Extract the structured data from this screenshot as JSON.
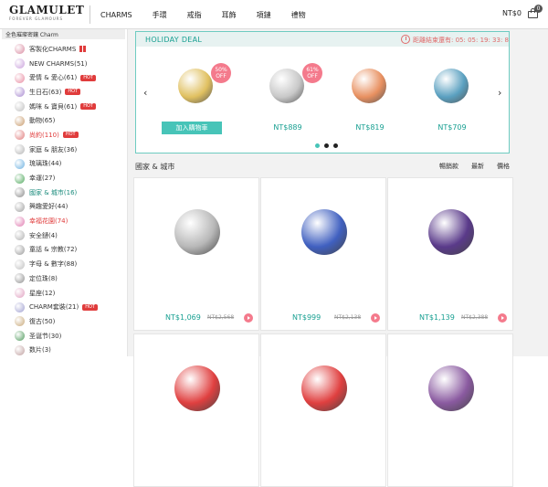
{
  "header": {
    "logo": "GLAMULET",
    "logo_sub": "FOREVER GLAMOURS",
    "nav": [
      "CHARMS",
      "手環",
      "戒指",
      "耳飾",
      "項鏈",
      "禮物"
    ],
    "cart_total": "NT$0",
    "cart_count": "0"
  },
  "sidebar": {
    "header": "全色璀璨密鑲 Charm",
    "items": [
      {
        "label": "客製化CHARMS",
        "badge": "gift",
        "style": "normal",
        "color": "#d98aa0"
      },
      {
        "label": "NEW CHARMS(51)",
        "badge": "",
        "style": "normal",
        "color": "#c9a0dc"
      },
      {
        "label": "愛情 & 愛心(61)",
        "badge": "HOT",
        "style": "normal",
        "color": "#e88aa0"
      },
      {
        "label": "生日石(63)",
        "badge": "HOT",
        "style": "normal",
        "color": "#a889d0"
      },
      {
        "label": "媽咪 & 寶貝(61)",
        "badge": "HOT",
        "style": "normal",
        "color": "#c0c0c0"
      },
      {
        "label": "動物(65)",
        "badge": "",
        "style": "normal",
        "color": "#c89a6a"
      },
      {
        "label": "尚約(110)",
        "badge": "HOT",
        "style": "red",
        "color": "#e07a7a"
      },
      {
        "label": "家庭 & 朋友(36)",
        "badge": "",
        "style": "normal",
        "color": "#b5b5b5"
      },
      {
        "label": "琉璃珠(44)",
        "badge": "",
        "style": "normal",
        "color": "#6ab0e0"
      },
      {
        "label": "幸運(27)",
        "badge": "",
        "style": "normal",
        "color": "#4fa85c"
      },
      {
        "label": "國家 & 城市(16)",
        "badge": "",
        "style": "teal",
        "color": "#8a8a8a"
      },
      {
        "label": "興趣愛好(44)",
        "badge": "",
        "style": "normal",
        "color": "#a0a0a0"
      },
      {
        "label": "幸福花園(74)",
        "badge": "",
        "style": "red",
        "color": "#e07ab0"
      },
      {
        "label": "安全鏈(4)",
        "badge": "",
        "style": "normal",
        "color": "#b0b0b0"
      },
      {
        "label": "童話 & 宗教(72)",
        "badge": "",
        "style": "normal",
        "color": "#9a9a9a"
      },
      {
        "label": "字母 & 數字(88)",
        "badge": "",
        "style": "normal",
        "color": "#c0c0c0"
      },
      {
        "label": "定位珠(8)",
        "badge": "",
        "style": "normal",
        "color": "#909090"
      },
      {
        "label": "星座(12)",
        "badge": "",
        "style": "normal",
        "color": "#e0a0c0"
      },
      {
        "label": "CHARM套裝(21)",
        "badge": "HOT",
        "style": "normal",
        "color": "#a0a0d0"
      },
      {
        "label": "復古(50)",
        "badge": "",
        "style": "normal",
        "color": "#c8a878"
      },
      {
        "label": "圣诞节(30)",
        "badge": "",
        "style": "normal",
        "color": "#4f9a5c"
      },
      {
        "label": "数片(3)",
        "badge": "",
        "style": "normal",
        "color": "#c0a0a0"
      }
    ]
  },
  "deal": {
    "title": "HOLIDAY DEAL",
    "countdown": "距離結束還有: 05: 05: 19: 33: 8",
    "items": [
      {
        "percent": "50%",
        "off": "OFF",
        "price": "",
        "button": "加入購物車",
        "color": "#e0c060"
      },
      {
        "percent": "61%",
        "off": "OFF",
        "price": "NT$889",
        "button": "",
        "color": "#c8c8c8"
      },
      {
        "percent": "",
        "off": "",
        "price": "NT$819",
        "button": "",
        "color": "#e89060"
      },
      {
        "percent": "",
        "off": "",
        "price": "NT$709",
        "button": "",
        "color": "#5aa0c0"
      }
    ]
  },
  "category": {
    "title": "國家 & 城市",
    "sort": [
      "暢銷款",
      "最新",
      "價格"
    ]
  },
  "products": [
    {
      "price": "NT$1,069",
      "old": "NT$2,568",
      "color": "#b8b8b8"
    },
    {
      "price": "NT$999",
      "old": "NT$2,138",
      "color": "#4060c0"
    },
    {
      "price": "NT$1,139",
      "old": "NT$2,388",
      "color": "#5a3a8a"
    },
    {
      "price": "",
      "old": "",
      "color": "#e04040"
    },
    {
      "price": "",
      "old": "",
      "color": "#e04040"
    },
    {
      "price": "",
      "old": "",
      "color": "#8a5aa0"
    }
  ]
}
